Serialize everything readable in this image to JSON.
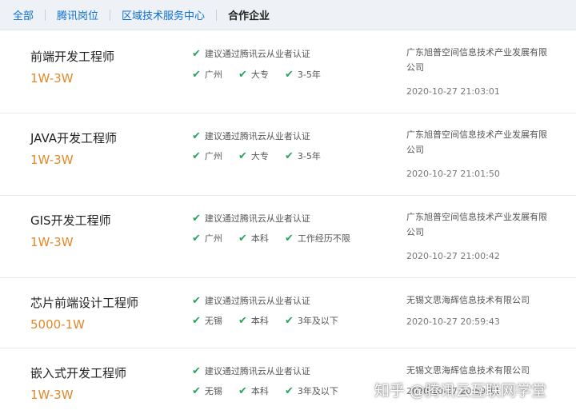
{
  "tabs": [
    "全部",
    "腾讯岗位",
    "区域技术服务中心",
    "合作企业"
  ],
  "active_tab": "合作企业",
  "jobs": [
    {
      "title": "前端开发工程师",
      "salary": "1W-3W",
      "cert": "建议通过腾讯云从业者认证",
      "tags": [
        "广州",
        "大专",
        "3-5年"
      ],
      "company": "广东旭普空间信息技术产业发展有限公司",
      "time": "2020-10-27 21:03:01"
    },
    {
      "title": "JAVA开发工程师",
      "salary": "1W-3W",
      "cert": "建议通过腾讯云从业者认证",
      "tags": [
        "广州",
        "大专",
        "3-5年"
      ],
      "company": "广东旭普空间信息技术产业发展有限公司",
      "time": "2020-10-27 21:01:50"
    },
    {
      "title": "GIS开发工程师",
      "salary": "1W-3W",
      "cert": "建议通过腾讯云从业者认证",
      "tags": [
        "广州",
        "本科",
        "工作经历不限"
      ],
      "company": "广东旭普空间信息技术产业发展有限公司",
      "time": "2020-10-27 21:00:42"
    },
    {
      "title": "芯片前端设计工程师",
      "salary": "5000-1W",
      "cert": "建议通过腾讯云从业者认证",
      "tags": [
        "无锡",
        "本科",
        "3年及以下"
      ],
      "company": "无锡文思海辉信息技术有限公司",
      "time": "2020-10-27 20:59:43"
    },
    {
      "title": "嵌入式开发工程师",
      "salary": "1W-3W",
      "cert": "建议通过腾讯云从业者认证",
      "tags": [
        "无锡",
        "本科",
        "3年及以下"
      ],
      "company": "无锡文思海辉信息技术有限公司",
      "time": "2020-10-27 20:59:11"
    }
  ],
  "watermark": "知乎 @腾讯云互联网学堂",
  "colors": {
    "link": "#0a6fd6",
    "salary": "#e3882b",
    "check": "#2aa45c",
    "tab_bg": "#eef1f6"
  }
}
